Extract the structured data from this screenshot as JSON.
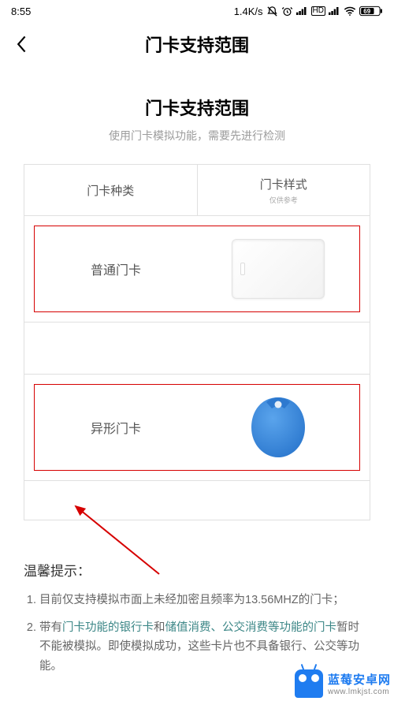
{
  "status": {
    "time": "8:55",
    "speed": "1.4K/s",
    "battery": "69"
  },
  "nav": {
    "title": "门卡支持范围"
  },
  "page": {
    "title": "门卡支持范围",
    "subtitle": "使用门卡模拟功能，需要先进行检测"
  },
  "table": {
    "head": {
      "type": "门卡种类",
      "style": "门卡样式",
      "style_sub": "仅供参考"
    },
    "rows": [
      {
        "label": "普通门卡",
        "icon": "white-card"
      },
      {
        "label": "异形门卡",
        "icon": "blue-keytag"
      }
    ]
  },
  "tips": {
    "title": "温馨提示：",
    "items": [
      {
        "pre": "目前仅支持模拟市面上未经加密且频率为13.56MHZ的门卡；"
      },
      {
        "pre": "带有",
        "hl1": "门卡功能的银行卡",
        "mid": "和",
        "hl2": "储值消费、公交消费等功能的门卡",
        "post": "暂时不能被模拟。即使模拟成功，这些卡片也不具备银行、公交等功能。"
      }
    ]
  },
  "watermark": {
    "name": "蓝莓安卓网",
    "url": "www.lmkjst.com"
  }
}
